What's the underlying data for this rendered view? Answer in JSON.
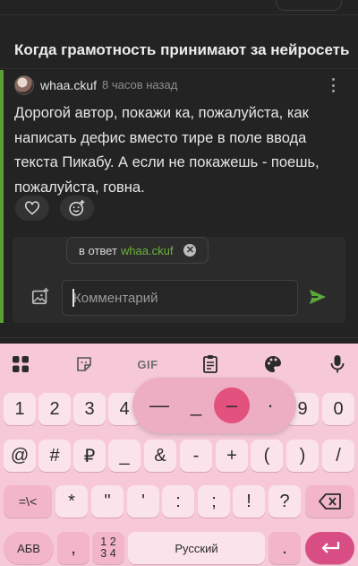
{
  "post": {
    "title": "Когда грамотность принимают за нейросеть"
  },
  "comment": {
    "author": "whaa.ckuf",
    "time": "8 часов назад",
    "text": "Дорогой автор, покажи ка, пожалуйста, как написать дефис вместо тире в поле ввода текста Пикабу. А если не покажешь - поешь, пожалуйста, говна."
  },
  "reply": {
    "prefix": "в ответ",
    "nick": "whaa.ckuf",
    "input_placeholder": "Комментарий"
  },
  "keyboard": {
    "toolbar": [
      "apps-grid-icon",
      "sticker-icon",
      "GIF",
      "clipboard-icon",
      "palette-icon",
      "microphone-icon"
    ],
    "gif_label": "GIF",
    "row1": [
      "1",
      "2",
      "3",
      "4",
      "9",
      "0"
    ],
    "popup": [
      "—",
      "_",
      "–",
      "·"
    ],
    "row2": [
      "@",
      "#",
      "₽",
      "_",
      "&",
      "-",
      "+",
      "(",
      ")",
      "/"
    ],
    "row3": [
      "=\\<",
      "*",
      "\"",
      "'",
      ":",
      ";",
      "!",
      "?"
    ],
    "row4": {
      "lang": "АБВ",
      "comma": ",",
      "numpad_top": "1 2",
      "numpad_bottom": "3 4",
      "space": "Русский",
      "period": "."
    },
    "accent": "#d94d85"
  }
}
